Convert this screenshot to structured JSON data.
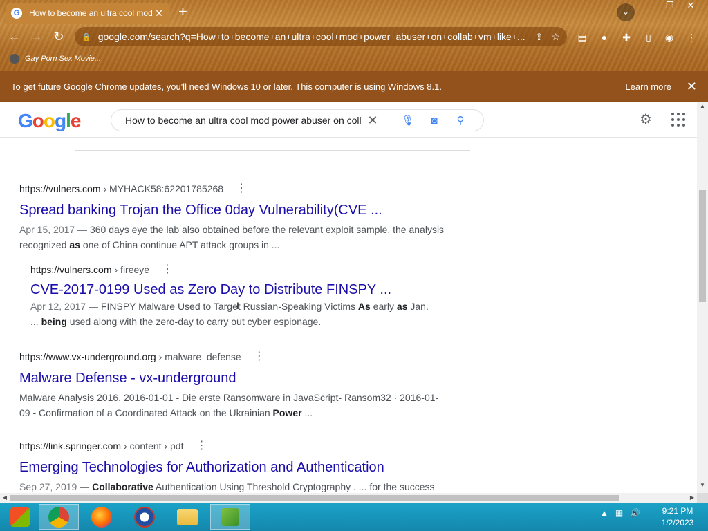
{
  "browser": {
    "tab_title": "How to become an ultra cool mod",
    "url": "google.com/search?q=How+to+become+an+ultra+cool+mod+power+abuser+on+collab+vm+like+...",
    "bookmark": "Gay Porn Sex Movie...",
    "infobar_message": "To get future Google Chrome updates, you'll need Windows 10 or later. This computer is using Windows 8.1.",
    "infobar_link": "Learn more"
  },
  "search": {
    "logo": [
      "G",
      "o",
      "o",
      "g",
      "l",
      "e"
    ],
    "query": "How to become an ultra cool mod power abuser on collab vm like"
  },
  "results": [
    {
      "domain": "https://vulners.com",
      "path": "› MYHACK58:62201785268",
      "title": "Spread banking Trojan the Office 0day Vulnerability(CVE ...",
      "date": "Apr 15, 2017 —",
      "snippet_a": " 360 days eye the lab also obtained before the relevant exploit sample, the analysis recognized ",
      "bold_a": "as",
      "snippet_b": " one of China continue APT attack groups in ..."
    },
    {
      "domain": "https://vulners.com",
      "path": "› fireeye",
      "title": "CVE-2017-0199 Used as Zero Day to Distribute FINSPY ...",
      "date": "Apr 12, 2017 —",
      "snippet_a": " FINSPY Malware Used to Target Russian-Speaking Victims ",
      "bold_a": "As",
      "snippet_b": " early ",
      "bold_b": "as",
      "snippet_c": " Jan. ... ",
      "bold_c": "being",
      "snippet_d": " used along with the zero-day to carry out cyber espionage."
    },
    {
      "domain": "https://www.vx-underground.org",
      "path": "› malware_defense",
      "title": "Malware Defense - vx-underground",
      "snippet_a": "Malware Analysis 2016. 2016-01-01 - Die erste Ransomware in JavaScript- Ransom32 · 2016-01-09 - Confirmation of a Coordinated Attack on the Ukrainian ",
      "bold_a": "Power",
      "snippet_b": " ..."
    },
    {
      "domain": "https://link.springer.com",
      "path": "› content › pdf",
      "title": "Emerging Technologies for Authorization and Authentication",
      "date": "Sep 27, 2019 —",
      "bold_a": "Collaborative",
      "snippet_a": " Authentication Using Threshold Cryptography . ... for the success"
    }
  ],
  "taskbar": {
    "time": "9:21 PM",
    "date": "1/2/2023"
  }
}
